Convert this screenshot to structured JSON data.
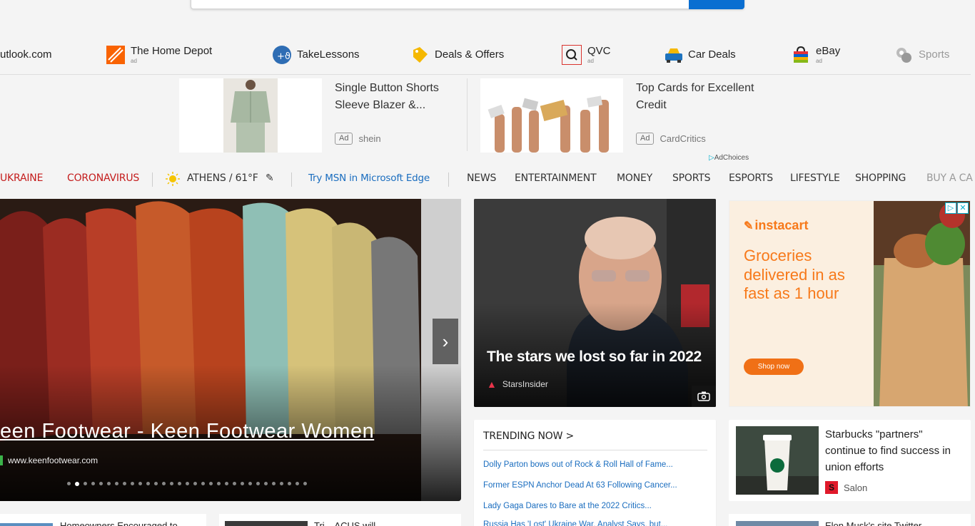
{
  "quicklinks": [
    {
      "label": "utlook.com",
      "ad": ""
    },
    {
      "label": "The Home Depot",
      "ad": "ad"
    },
    {
      "label": "TakeLessons",
      "ad": ""
    },
    {
      "label": "Deals & Offers",
      "ad": ""
    },
    {
      "label": "QVC",
      "ad": "ad"
    },
    {
      "label": "Car Deals",
      "ad": ""
    },
    {
      "label": "eBay",
      "ad": "ad"
    },
    {
      "label": "Sports",
      "ad": ""
    }
  ],
  "ads": [
    {
      "title": "Single Button Shorts Sleeve Blazer &...",
      "tag": "Ad",
      "source": "shein"
    },
    {
      "title": "Top Cards for Excellent Credit",
      "tag": "Ad",
      "source": "CardCritics"
    }
  ],
  "adchoices": "AdChoices",
  "nav": {
    "ukraine": "UKRAINE",
    "coronavirus": "CORONAVIRUS",
    "weather": "ATHENS / 61°F",
    "edge": "Try MSN in Microsoft Edge",
    "items": [
      "NEWS",
      "ENTERTAINMENT",
      "MONEY",
      "SPORTS",
      "ESPORTS",
      "LIFESTYLE",
      "SHOPPING",
      "BUY A CA"
    ]
  },
  "hero": {
    "title": "een Footwear - Keen Footwear Women",
    "source": "www.keenfootwear.com",
    "dot_count": 31,
    "active_dot": 1
  },
  "stars_card": {
    "title": "The stars we lost so far in 2022",
    "source": "StarsInsider"
  },
  "instacart": {
    "logo": "instacart",
    "headline": "Groceries delivered in as fast as 1 hour",
    "cta": "Shop now"
  },
  "trending": {
    "header": "TRENDING NOW >",
    "items": [
      "Dolly Parton bows out of Rock & Roll Hall of Fame...",
      "Former ESPN Anchor Dead At 63 Following Cancer...",
      "Lady Gaga Dares to Bare at the 2022 Critics...",
      "Russia Has 'Lost' Ukraine War, Analyst Says, but..."
    ]
  },
  "side_story": {
    "title": "Starbucks \"partners\" continue to find success in union efforts",
    "source": "Salon"
  },
  "bottom": {
    "left": "Homeowners Encouraged to",
    "mid": "Tri... ACUS will",
    "right": "Elon Musk's site Twitter"
  },
  "colors": {
    "accent": "#1a6dbf",
    "alert": "#c41c1c",
    "instacart": "#f7791a"
  }
}
